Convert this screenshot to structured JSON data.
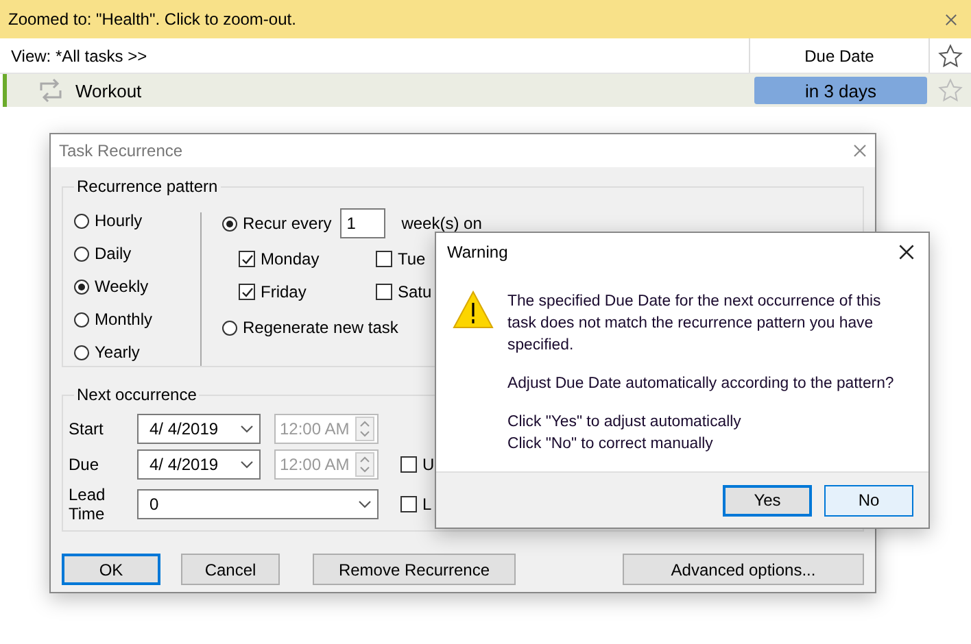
{
  "banner": {
    "text": "Zoomed to: \"Health\". Click to zoom-out."
  },
  "view_bar": {
    "view": "View: *All tasks >>",
    "column": "Due Date"
  },
  "tasks": [
    {
      "title": "Workout",
      "due": "in 3 days",
      "starred": false
    }
  ],
  "recurrence_dialog": {
    "title": "Task Recurrence",
    "pattern": {
      "label": "Recurrence pattern",
      "options": [
        {
          "label": "Hourly",
          "selected": false
        },
        {
          "label": "Daily",
          "selected": false
        },
        {
          "label": "Weekly",
          "selected": true
        },
        {
          "label": "Monthly",
          "selected": false
        },
        {
          "label": "Yearly",
          "selected": false
        }
      ],
      "recur": {
        "label": "Recur every",
        "selected": true,
        "value": "1",
        "unit": "week(s) on"
      },
      "days": [
        {
          "label": "Monday",
          "checked": true
        },
        {
          "label": "Tue",
          "checked": false
        },
        {
          "label": "Friday",
          "checked": true
        },
        {
          "label": "Satu",
          "checked": false
        }
      ],
      "regenerate": {
        "label": "Regenerate new task",
        "selected": false
      }
    },
    "next": {
      "label": "Next occurrence",
      "rows": [
        {
          "label": "Start",
          "date": "4/  4/2019",
          "time": "12:00 AM"
        },
        {
          "label": "Due",
          "date": "4/  4/2019",
          "time": "12:00 AM"
        }
      ],
      "lead": {
        "label": "Lead Time",
        "value": "0"
      },
      "checks": [
        {
          "label": "U",
          "checked": false
        },
        {
          "label": "L",
          "checked": false
        }
      ]
    },
    "buttons": [
      {
        "label": "OK",
        "default": true
      },
      {
        "label": "Cancel",
        "default": false
      },
      {
        "label": "Remove Recurrence",
        "default": false
      },
      {
        "label": "Advanced options...",
        "default": false
      }
    ]
  },
  "warning": {
    "title": "Warning",
    "paragraphs": [
      [
        "The specified Due Date for the next occurrence of this task does not match the recurrence pattern you have specified."
      ],
      [
        "Adjust Due Date automatically according to the pattern?"
      ],
      [
        "Click \"Yes\" to adjust automatically",
        "Click \"No\" to correct manually"
      ]
    ],
    "buttons": [
      {
        "label": "Yes",
        "default": true,
        "hovered": false
      },
      {
        "label": "No",
        "default": false,
        "hovered": true
      }
    ]
  }
}
